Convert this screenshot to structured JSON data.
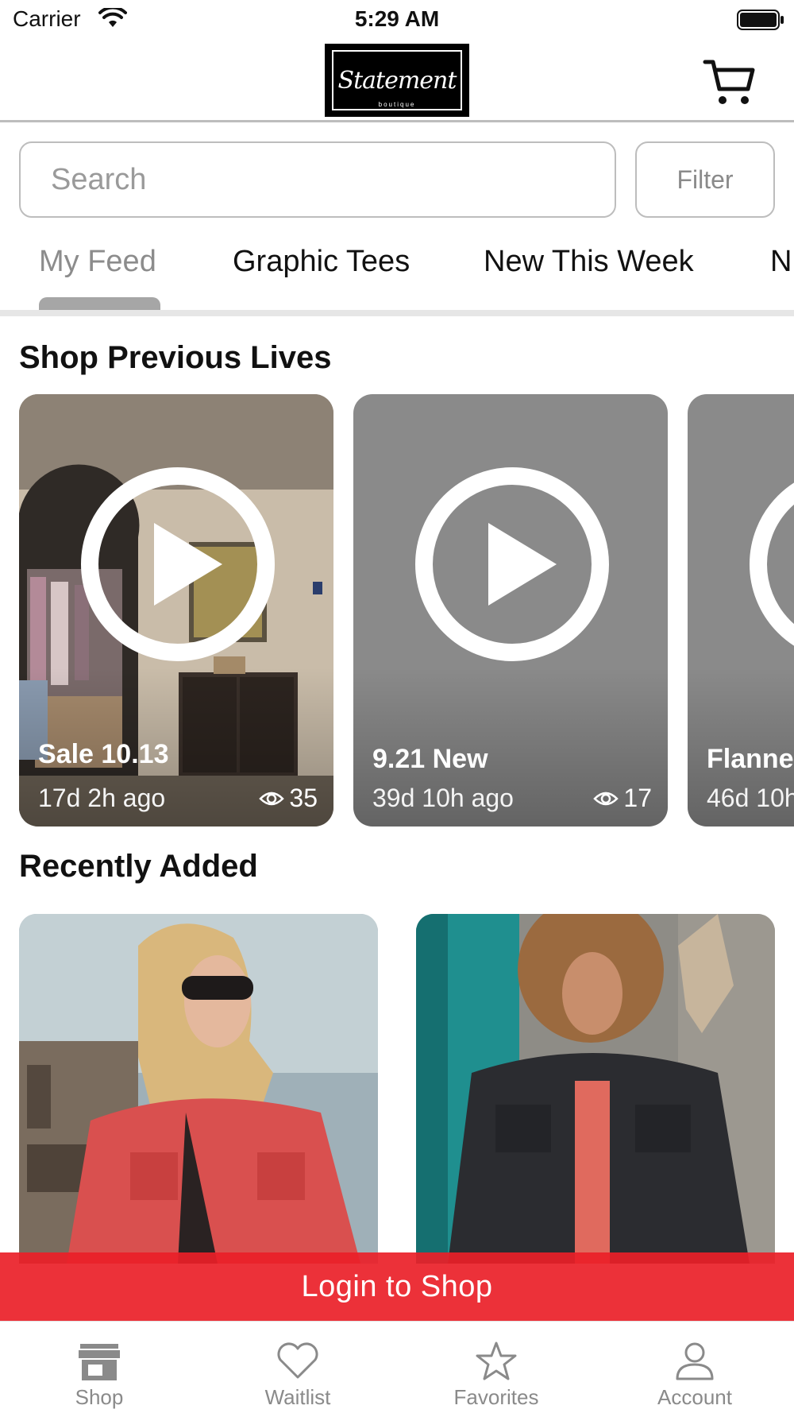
{
  "status_bar": {
    "carrier": "Carrier",
    "time": "5:29 AM"
  },
  "header": {
    "logo_text": "Statement",
    "logo_subtext": "boutique",
    "cart_icon": "cart-icon"
  },
  "search": {
    "placeholder": "Search",
    "value": ""
  },
  "filter": {
    "label": "Filter"
  },
  "tabs": [
    {
      "label": "My Feed",
      "active": true
    },
    {
      "label": "Graphic Tees",
      "active": false
    },
    {
      "label": "New This Week",
      "active": false
    },
    {
      "label": "N",
      "active": false
    }
  ],
  "sections": {
    "previous_lives": "Shop Previous Lives",
    "recently_added": "Recently Added"
  },
  "lives": [
    {
      "title": "Sale 10.13",
      "ago": "17d 2h ago",
      "views": "35"
    },
    {
      "title": "9.21 New",
      "ago": "39d 10h ago",
      "views": "17"
    },
    {
      "title": "Flannel",
      "ago": "46d 10h",
      "views": ""
    }
  ],
  "login_banner": {
    "label": "Login to Shop"
  },
  "bottom_nav": [
    {
      "label": "Shop",
      "icon": "store-icon",
      "active": true
    },
    {
      "label": "Waitlist",
      "icon": "heart-icon",
      "active": false
    },
    {
      "label": "Favorites",
      "icon": "star-icon",
      "active": false
    },
    {
      "label": "Account",
      "icon": "person-icon",
      "active": false
    }
  ],
  "colors": {
    "accent_red": "#ea2028",
    "tab_active": "#8c8c8c",
    "muted": "#8a8a8a"
  }
}
